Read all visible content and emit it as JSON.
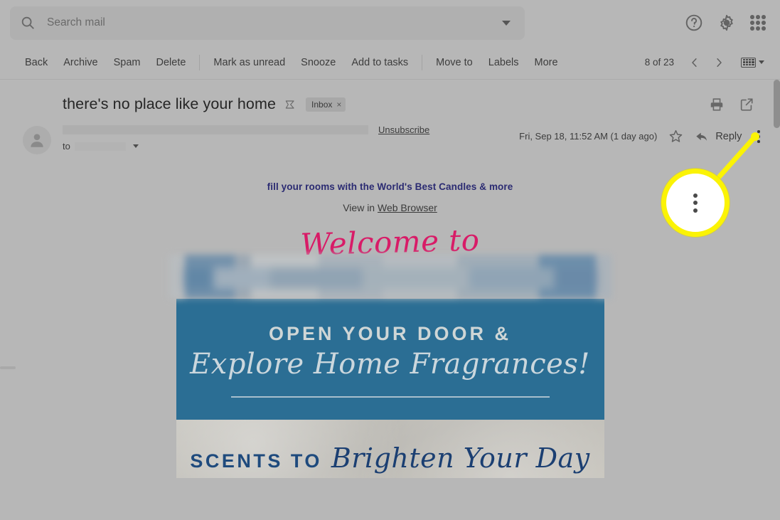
{
  "topbar": {
    "search_placeholder": "Search mail",
    "search_value": "",
    "search_icon": "search-icon",
    "options_caret_icon": "chevron-down-icon",
    "help_icon": "help-icon",
    "settings_icon": "gear-icon",
    "apps_icon": "apps-grid-icon"
  },
  "toolbar": {
    "items": [
      {
        "label": "Back"
      },
      {
        "label": "Archive"
      },
      {
        "label": "Spam"
      },
      {
        "label": "Delete"
      },
      {
        "label": "Mark as unread"
      },
      {
        "label": "Snooze"
      },
      {
        "label": "Add to tasks"
      },
      {
        "label": "Move to"
      },
      {
        "label": "Labels"
      },
      {
        "label": "More"
      }
    ],
    "counter": "8 of 23",
    "prev_icon": "chevron-left-icon",
    "next_icon": "chevron-right-icon",
    "keyboard_icon": "keyboard-icon",
    "keyboard_caret_icon": "chevron-down-icon"
  },
  "email": {
    "subject": "there's no place like your home",
    "important_marker_icon": "important-marker-icon",
    "label_chip": "Inbox",
    "label_chip_remove": "×",
    "print_icon": "print-icon",
    "popout_icon": "open-in-new-window-icon",
    "avatar_icon": "avatar-icon",
    "sender_redacted": "",
    "to_label": "to",
    "to_redacted": "",
    "to_caret_icon": "chevron-down-icon",
    "unsubscribe": "Unsubscribe",
    "date": "Fri, Sep 18, 11:52 AM (1 day ago)",
    "star_icon": "star-icon",
    "reply_icon": "reply-arrow-icon",
    "reply_label": "Reply",
    "more_options_icon": "more-options-icon"
  },
  "message_body": {
    "preheader": "fill your rooms with the World's Best Candles & more",
    "view_in_prefix": "View in ",
    "view_in_link": "Web Browser",
    "welcome_script": "Welcome to",
    "banner_line1": "OPEN YOUR DOOR &",
    "banner_line2": "Explore Home Fragrances!",
    "scents_caps": "SCENTS TO",
    "scents_script": "Brighten Your Day"
  },
  "callout": {
    "target_icon": "more-options-icon",
    "highlight_color": "#fbf305"
  },
  "colors": {
    "banner_blue": "#2b6e94",
    "preheader_navy": "#2b2b72",
    "script_pink": "#d81b67",
    "scents_navy": "#1e4a7d",
    "highlight_yellow": "#fbf305",
    "page_dim": "#b7b7b7"
  }
}
